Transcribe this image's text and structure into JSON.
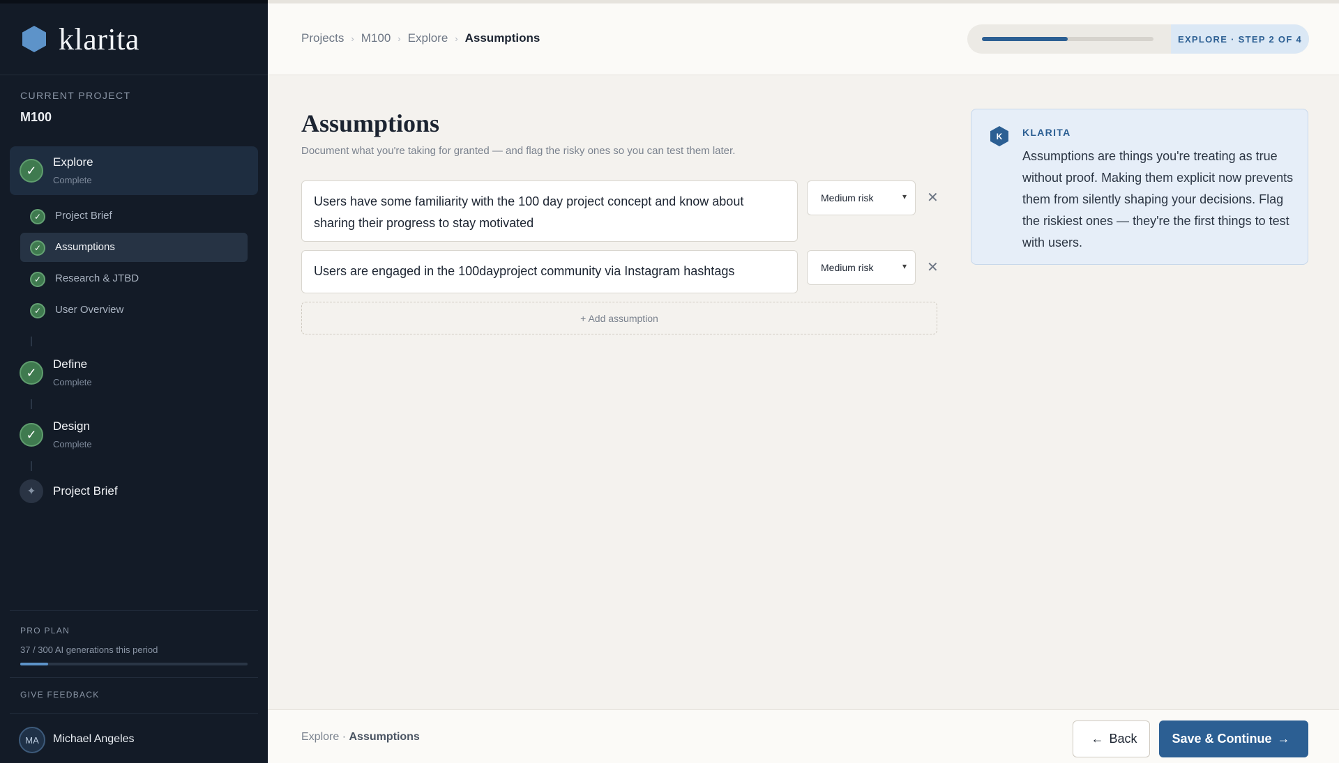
{
  "app": {
    "name": "klarita"
  },
  "sidebar": {
    "current_project_label": "CURRENT PROJECT",
    "current_project": "M100",
    "phases": [
      {
        "title": "Explore",
        "status": "Complete"
      },
      {
        "title": "Define",
        "status": "Complete"
      },
      {
        "title": "Design",
        "status": "Complete"
      },
      {
        "title": "Project Brief",
        "status": ""
      }
    ],
    "explore_items": [
      {
        "label": "Project Brief"
      },
      {
        "label": "Assumptions"
      },
      {
        "label": "Research & JTBD"
      },
      {
        "label": "User Overview"
      }
    ],
    "plan_label": "PRO PLAN",
    "plan_usage": "37 / 300 AI generations this period",
    "plan_progress": 0.123,
    "feedback_label": "GIVE FEEDBACK",
    "user": {
      "initials": "MA",
      "name": "Michael Angeles"
    }
  },
  "header": {
    "breadcrumbs": [
      "Projects",
      "M100",
      "Explore",
      "Assumptions"
    ],
    "step_label": "EXPLORE · STEP 2 OF 4",
    "step_progress": 0.5
  },
  "main": {
    "title": "Assumptions",
    "subtitle": "Document what you're taking for granted — and flag the risky ones so you can test them later.",
    "assumptions": [
      {
        "text": "Users have some familiarity with the 100 day project concept and know about sharing their progress to stay motivated",
        "risk": "Medium risk"
      },
      {
        "text": "Users are engaged in the 100dayproject community via Instagram hashtags",
        "risk": "Medium risk"
      }
    ],
    "add_label": "+ Add assumption"
  },
  "tip": {
    "badge": "K",
    "label": "KLARITA",
    "text": "Assumptions are things you're treating as true without proof. Making them explicit now prevents them from silently shaping your decisions. Flag the riskiest ones — they're the first things to test with users."
  },
  "footer": {
    "crumb_phase": "Explore ·",
    "crumb_page": "Assumptions",
    "back_label": "Back",
    "save_label": "Save & Continue"
  },
  "icons": {
    "check": "check-icon",
    "remove": "close-icon",
    "select": "chevron-down-icon",
    "arrow_left": "arrow-left-icon",
    "arrow_right": "arrow-right-icon"
  },
  "colors": {
    "sidebar_bg": "#131b27",
    "accent": "#2c5f93",
    "success": "#3f7a4f",
    "page_bg": "#f4f2ee"
  }
}
